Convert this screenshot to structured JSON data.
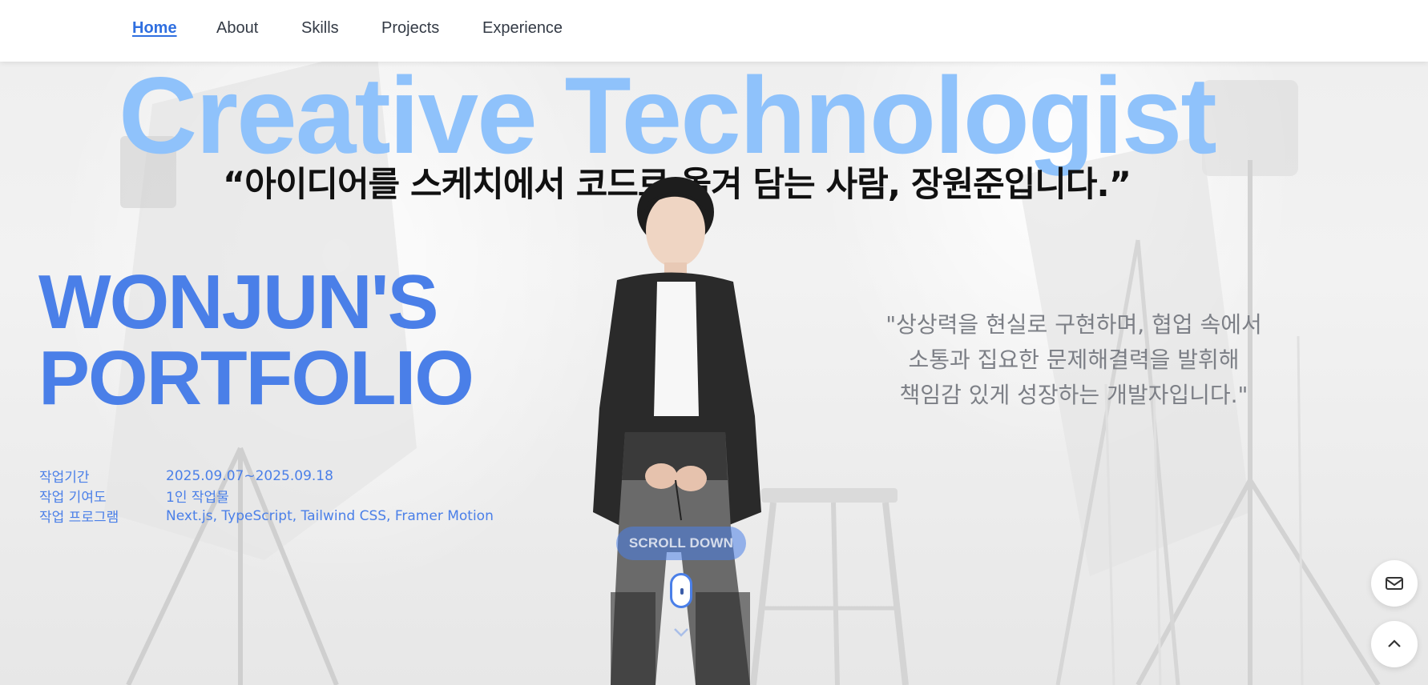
{
  "nav": {
    "items": [
      {
        "label": "Home",
        "active": true
      },
      {
        "label": "About",
        "active": false
      },
      {
        "label": "Skills",
        "active": false
      },
      {
        "label": "Projects",
        "active": false
      },
      {
        "label": "Experience",
        "active": false
      }
    ]
  },
  "hero": {
    "title": "Creative Technologist",
    "quote": "“아이디어를 스케치에서 코드로 옮겨 담는 사람, 장원준입니다.”",
    "portfolio_line1": "WONJUN'S",
    "portfolio_line2": "PORTFOLIO",
    "bio_line1": "\"상상력을 현실로 구현하며, 협업 속에서",
    "bio_line2": "소통과 집요한 문제해결력을 발휘해",
    "bio_line3": "책임감 있게 성장하는 개발자입니다.\""
  },
  "meta": [
    {
      "key": "작업기간",
      "value": "2025.09.07~2025.09.18"
    },
    {
      "key": "작업 기여도",
      "value": "1인 작업물"
    },
    {
      "key": "작업 프로그램",
      "value": "Next.js, TypeScript, Tailwind CSS, Framer Motion"
    }
  ],
  "scroll": {
    "label": "SCROLL DOWN"
  },
  "icons": {
    "mail": "mail-icon",
    "top": "chevron-up-icon",
    "scroll": "chevron-down-icon"
  },
  "colors": {
    "accent": "#4a7fe8",
    "title": "#8fc2fb",
    "nav_active": "#2f6fe0"
  }
}
